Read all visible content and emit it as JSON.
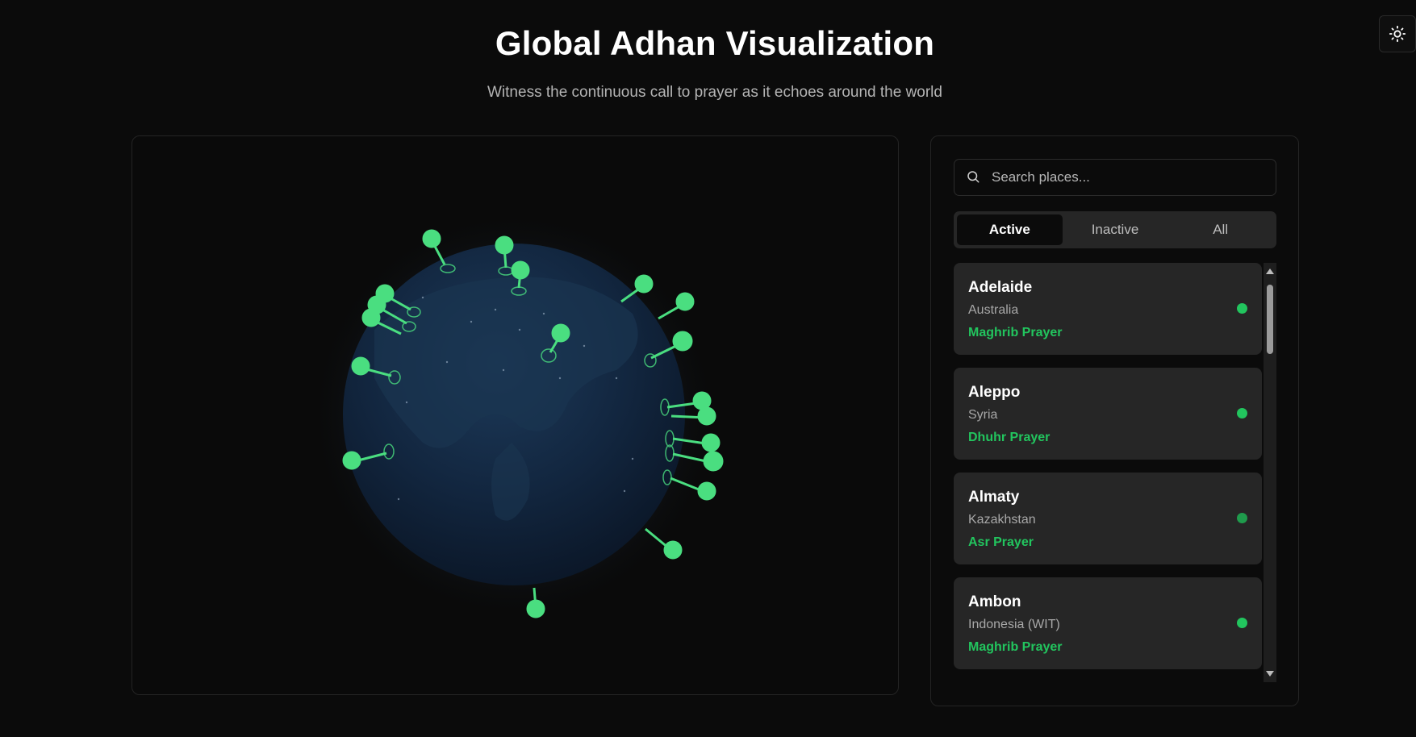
{
  "header": {
    "title": "Global Adhan Visualization",
    "subtitle": "Witness the continuous call to prayer as it echoes around the world",
    "theme_toggle_icon": "sun-icon"
  },
  "colors": {
    "background": "#0b0b0b",
    "accent": "#22c55e",
    "card": "#262626",
    "muted_text": "#a8a8a8"
  },
  "sidebar": {
    "search": {
      "placeholder": "Search places...",
      "value": "",
      "icon": "search-icon"
    },
    "tabs": [
      {
        "label": "Active",
        "selected": true
      },
      {
        "label": "Inactive",
        "selected": false
      },
      {
        "label": "All",
        "selected": false
      }
    ],
    "places": [
      {
        "city": "Adelaide",
        "country": "Australia",
        "prayer": "Maghrib Prayer",
        "status": "active"
      },
      {
        "city": "Aleppo",
        "country": "Syria",
        "prayer": "Dhuhr Prayer",
        "status": "active"
      },
      {
        "city": "Almaty",
        "country": "Kazakhstan",
        "prayer": "Asr Prayer",
        "status": "active"
      },
      {
        "city": "Ambon",
        "country": "Indonesia (WIT)",
        "prayer": "Maghrib Prayer",
        "status": "active"
      }
    ]
  }
}
